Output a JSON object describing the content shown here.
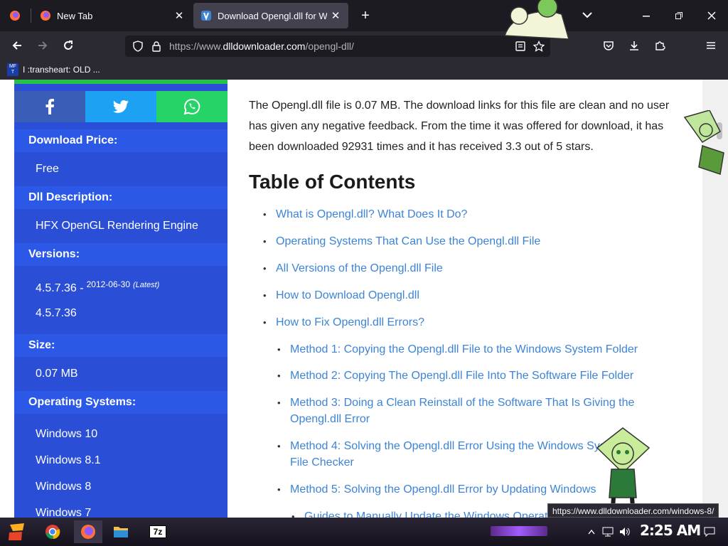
{
  "tabs": [
    {
      "label": "New Tab",
      "icon": "firefox-icon"
    },
    {
      "label": "Download Opengl.dll for Windows",
      "icon": "dll-site-icon",
      "active": true
    }
  ],
  "url": {
    "prefix": "https://www.",
    "domain": "dlldownloader.com",
    "path": "/opengl-dll/"
  },
  "bookmarks": [
    {
      "label": "I :transheart: OLD ...",
      "icon_text": "MF T"
    }
  ],
  "sidebar": {
    "share": [
      "facebook-icon",
      "twitter-icon",
      "whatsapp-icon"
    ],
    "download_price_label": "Download Price:",
    "download_price": "Free",
    "description_label": "Dll Description:",
    "description": "HFX OpenGL Rendering Engine",
    "versions_label": "Versions:",
    "versions": [
      {
        "version": "4.5.7.36",
        "date": "2012-06-30",
        "latest": "(Latest)"
      },
      {
        "version": "4.5.7.36"
      }
    ],
    "size_label": "Size:",
    "size": "0.07 MB",
    "os_label": "Operating Systems:",
    "os": [
      "Windows 10",
      "Windows 8.1",
      "Windows 8",
      "Windows 7"
    ]
  },
  "main": {
    "intro": "The Opengl.dll file is 0.07 MB. The download links for this file are clean and no user has given any negative feedback. From the time it was offered for download, it has been downloaded 92931 times and it has received 3.3 out of 5 stars.",
    "toc_title": "Table of Contents",
    "toc": [
      "What is Opengl.dll? What Does It Do?",
      "Operating Systems That Can Use the Opengl.dll File",
      "All Versions of the Opengl.dll File",
      "How to Download Opengl.dll",
      "How to Fix Opengl.dll Errors?"
    ],
    "toc_sub": [
      "Method 1: Copying the Opengl.dll File to the Windows System Folder",
      "Method 2: Copying The Opengl.dll File Into The Software File Folder",
      "Method 3: Doing a Clean Reinstall of the Software That Is Giving the Opengl.dll Error",
      "Method 4: Solving the Opengl.dll Error Using the Windows System File Checker",
      "Method 5: Solving the Opengl.dll Error by Updating Windows",
      "Guides to Manually Update the Windows Operating System"
    ]
  },
  "status_url": "https://www.dlldownloader.com/windows-8/",
  "taskbar": {
    "clock": "2:25 AM",
    "seven_zip": "7z"
  }
}
